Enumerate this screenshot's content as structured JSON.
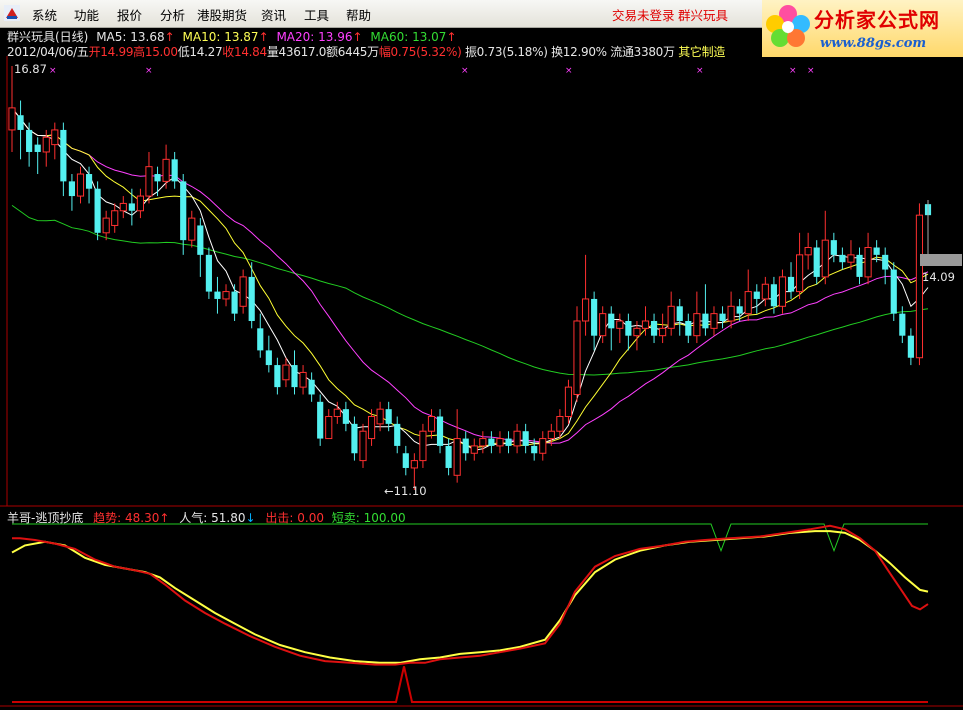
{
  "menubar": {
    "items": [
      "系统",
      "功能",
      "报价",
      "分析",
      "港股期货",
      "资讯",
      "工具",
      "帮助"
    ],
    "login_status": "交易未登录",
    "stock_name": "群兴玩具"
  },
  "logo": {
    "title": "分析家公式网",
    "url": "www.88gs.com"
  },
  "header": {
    "title": "群兴玩具(日线)",
    "ma5": {
      "label": "MA5: 13.68"
    },
    "ma10": {
      "label": "MA10: 13.87"
    },
    "ma20": {
      "label": "MA20: 13.96"
    },
    "ma60": {
      "label": "MA60: 13.07"
    },
    "date": "2012/04/06/五",
    "open": "开14.99",
    "high": "高15.00",
    "low": "低14.27",
    "close": "收14.84",
    "volume": "量43617.0",
    "amount": "额6445万",
    "change": "幅0.75(5.32%)",
    "amplitude": "振0.73(5.18%)",
    "turnover": "换12.90%",
    "float": "流通3380万",
    "sector": "其它制造"
  },
  "price_labels": {
    "high": "16.87",
    "low": "←11.10",
    "current": "14.09"
  },
  "indicator": {
    "name": "羊哥-逃顶抄底",
    "trend": "趋势: 48.30",
    "popularity": "人气: 51.80",
    "exit": "出击: 0.00",
    "short_sell": "短卖: 100.00"
  },
  "colors": {
    "up": "#ff3030",
    "down": "#54f0f0",
    "ma5": "#ffffff",
    "ma10": "#ffff33",
    "ma20": "#ff40ff",
    "ma60": "#22cc22",
    "trend": "#dd1111",
    "popularity": "#ffff44",
    "exit": "#cc0000"
  },
  "chart_data": {
    "type": "candlestick",
    "candles": [
      [
        16.0,
        16.3,
        16.87,
        15.7
      ],
      [
        16.2,
        16.0,
        16.4,
        15.6
      ],
      [
        16.0,
        15.7,
        16.1,
        15.5
      ],
      [
        15.8,
        15.7,
        15.9,
        15.4
      ],
      [
        15.7,
        15.9,
        16.0,
        15.5
      ],
      [
        15.8,
        16.0,
        16.1,
        15.6
      ],
      [
        16.0,
        15.3,
        16.1,
        15.1
      ],
      [
        15.3,
        15.1,
        15.4,
        14.9
      ],
      [
        15.1,
        15.4,
        15.5,
        15.0
      ],
      [
        15.4,
        15.2,
        15.5,
        15.0
      ],
      [
        15.2,
        14.6,
        15.3,
        14.5
      ],
      [
        14.6,
        14.8,
        14.9,
        14.5
      ],
      [
        14.7,
        14.9,
        15.0,
        14.6
      ],
      [
        14.9,
        15.0,
        15.1,
        14.8
      ],
      [
        15.0,
        14.9,
        15.2,
        14.7
      ],
      [
        14.9,
        15.1,
        15.2,
        14.8
      ],
      [
        15.1,
        15.5,
        15.7,
        15.0
      ],
      [
        15.4,
        15.3,
        15.5,
        15.1
      ],
      [
        15.3,
        15.6,
        15.8,
        15.2
      ],
      [
        15.6,
        15.3,
        15.7,
        15.2
      ],
      [
        15.3,
        14.5,
        15.4,
        14.3
      ],
      [
        14.5,
        14.8,
        14.9,
        14.4
      ],
      [
        14.7,
        14.3,
        14.8,
        14.0
      ],
      [
        14.3,
        13.8,
        14.4,
        13.7
      ],
      [
        13.8,
        13.7,
        14.0,
        13.5
      ],
      [
        13.7,
        13.8,
        13.9,
        13.6
      ],
      [
        13.8,
        13.5,
        13.9,
        13.4
      ],
      [
        13.6,
        14.0,
        14.1,
        13.5
      ],
      [
        14.0,
        13.4,
        14.2,
        13.3
      ],
      [
        13.3,
        13.0,
        13.5,
        12.9
      ],
      [
        13.0,
        12.8,
        13.2,
        12.7
      ],
      [
        12.8,
        12.5,
        12.9,
        12.4
      ],
      [
        12.6,
        12.8,
        12.9,
        12.5
      ],
      [
        12.8,
        12.5,
        13.0,
        12.4
      ],
      [
        12.5,
        12.7,
        12.8,
        12.4
      ],
      [
        12.6,
        12.4,
        12.7,
        12.3
      ],
      [
        12.3,
        11.8,
        12.4,
        11.7
      ],
      [
        11.8,
        12.1,
        12.2,
        11.8
      ],
      [
        12.1,
        12.2,
        12.3,
        12.0
      ],
      [
        12.2,
        12.0,
        12.3,
        11.9
      ],
      [
        12.0,
        11.6,
        12.1,
        11.5
      ],
      [
        11.5,
        11.9,
        12.0,
        11.4
      ],
      [
        11.8,
        12.1,
        12.2,
        11.7
      ],
      [
        12.0,
        12.2,
        12.3,
        11.9
      ],
      [
        12.2,
        12.0,
        12.3,
        11.9
      ],
      [
        12.0,
        11.7,
        12.1,
        11.6
      ],
      [
        11.6,
        11.4,
        11.7,
        11.3
      ],
      [
        11.4,
        11.5,
        11.6,
        11.1
      ],
      [
        11.5,
        11.9,
        12.0,
        11.4
      ],
      [
        11.9,
        12.1,
        12.2,
        11.8
      ],
      [
        12.1,
        11.7,
        12.2,
        11.6
      ],
      [
        11.7,
        11.4,
        11.8,
        11.3
      ],
      [
        11.3,
        11.8,
        12.2,
        11.2
      ],
      [
        11.8,
        11.6,
        11.9,
        11.5
      ],
      [
        11.6,
        11.7,
        11.8,
        11.5
      ],
      [
        11.7,
        11.8,
        11.9,
        11.6
      ],
      [
        11.8,
        11.7,
        11.9,
        11.6
      ],
      [
        11.7,
        11.8,
        11.9,
        11.6
      ],
      [
        11.8,
        11.7,
        11.9,
        11.6
      ],
      [
        11.7,
        11.9,
        12.0,
        11.6
      ],
      [
        11.9,
        11.7,
        12.0,
        11.6
      ],
      [
        11.7,
        11.6,
        11.8,
        11.5
      ],
      [
        11.6,
        11.8,
        11.9,
        11.5
      ],
      [
        11.8,
        11.9,
        12.0,
        11.7
      ],
      [
        11.9,
        12.1,
        12.2,
        11.8
      ],
      [
        12.1,
        12.5,
        12.6,
        12.0
      ],
      [
        12.4,
        13.4,
        13.6,
        12.3
      ],
      [
        13.4,
        13.7,
        14.3,
        13.2
      ],
      [
        13.7,
        13.2,
        13.8,
        13.0
      ],
      [
        13.2,
        13.5,
        13.6,
        13.1
      ],
      [
        13.5,
        13.3,
        13.6,
        13.0
      ],
      [
        13.3,
        13.4,
        13.5,
        13.1
      ],
      [
        13.4,
        13.2,
        13.5,
        13.0
      ],
      [
        13.2,
        13.3,
        13.4,
        13.0
      ],
      [
        13.3,
        13.4,
        13.6,
        13.2
      ],
      [
        13.4,
        13.2,
        13.5,
        13.1
      ],
      [
        13.2,
        13.3,
        13.5,
        13.1
      ],
      [
        13.3,
        13.6,
        13.8,
        13.2
      ],
      [
        13.6,
        13.4,
        13.7,
        13.2
      ],
      [
        13.4,
        13.2,
        13.5,
        13.1
      ],
      [
        13.2,
        13.5,
        13.8,
        13.1
      ],
      [
        13.5,
        13.3,
        13.9,
        13.2
      ],
      [
        13.3,
        13.5,
        13.6,
        13.2
      ],
      [
        13.5,
        13.4,
        13.6,
        13.3
      ],
      [
        13.4,
        13.6,
        13.8,
        13.3
      ],
      [
        13.6,
        13.5,
        13.7,
        13.4
      ],
      [
        13.5,
        13.8,
        14.1,
        13.4
      ],
      [
        13.8,
        13.7,
        13.9,
        13.5
      ],
      [
        13.7,
        13.9,
        14.0,
        13.6
      ],
      [
        13.9,
        13.6,
        14.0,
        13.5
      ],
      [
        13.6,
        14.0,
        14.1,
        13.5
      ],
      [
        14.0,
        13.8,
        14.2,
        13.7
      ],
      [
        13.8,
        14.3,
        14.6,
        13.7
      ],
      [
        14.3,
        14.4,
        14.6,
        14.1
      ],
      [
        14.4,
        14.0,
        14.5,
        13.9
      ],
      [
        14.0,
        14.5,
        14.9,
        13.9
      ],
      [
        14.5,
        14.3,
        14.6,
        14.2
      ],
      [
        14.3,
        14.2,
        14.4,
        14.1
      ],
      [
        14.2,
        14.3,
        14.5,
        14.1
      ],
      [
        14.3,
        14.0,
        14.4,
        13.9
      ],
      [
        14.0,
        14.4,
        14.6,
        13.9
      ],
      [
        14.4,
        14.3,
        14.5,
        14.2
      ],
      [
        14.3,
        14.1,
        14.4,
        13.9
      ],
      [
        14.1,
        13.5,
        14.2,
        13.4
      ],
      [
        13.5,
        13.2,
        13.6,
        13.1
      ],
      [
        13.2,
        12.9,
        13.3,
        12.8
      ],
      [
        12.9,
        14.84,
        15.0,
        12.8
      ],
      [
        14.99,
        14.84,
        15.0,
        14.27
      ]
    ],
    "ma_lines": [
      "MA5",
      "MA10",
      "MA20",
      "MA60"
    ],
    "indicator_series": [
      "趋势",
      "人气",
      "出击",
      "短卖"
    ]
  }
}
